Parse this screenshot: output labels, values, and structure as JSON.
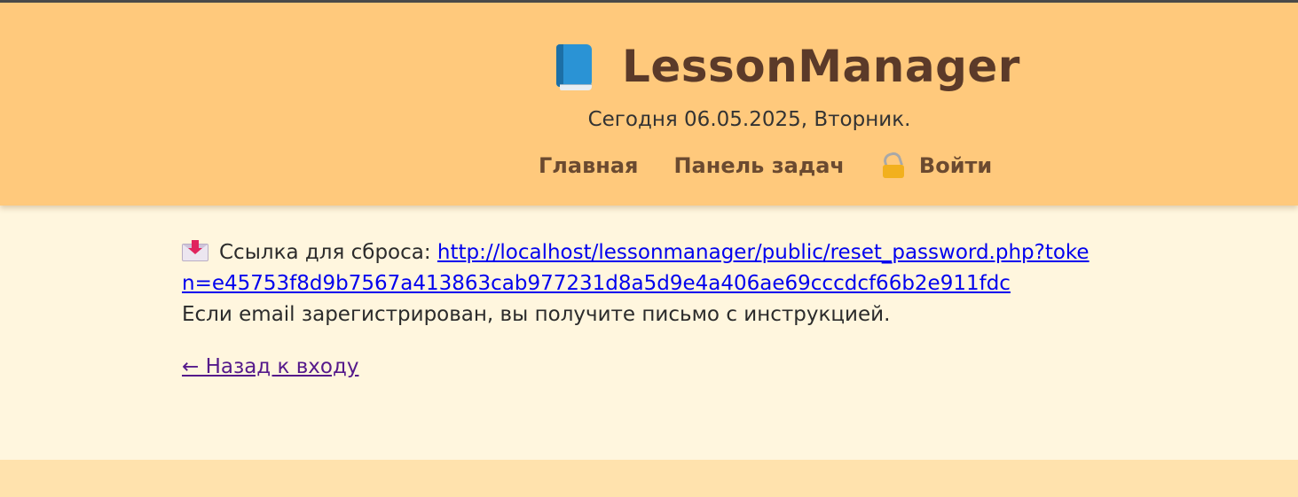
{
  "header": {
    "app_title": "LessonManager",
    "logo_icon": "blue-book-icon",
    "today_text": "Сегодня 06.05.2025, Вторник.",
    "nav": {
      "home_label": "Главная",
      "tasks_label": "Панель задач",
      "login_label": "Войти",
      "login_icon": "lock-icon"
    }
  },
  "main": {
    "mail_icon": "incoming-envelope-icon",
    "reset_prefix": "Ссылка для сброса:",
    "reset_url": "http://localhost/lessonmanager/public/reset_password.php?token=e45753f8d9b7567a413863cab977231d8a5d9e4a406ae69cccdcf66b2e911fdc",
    "info_text": "Если email зарегистрирован, вы получите письмо с инструкцией.",
    "back_link_label": "← Назад к входу"
  },
  "colors": {
    "header_bg": "#ffc97c",
    "main_bg": "#fff6de",
    "footer_bg": "#ffe2ad",
    "title_color": "#5b3a29",
    "link_color": "#0000ee",
    "visited_link_color": "#551a8b"
  }
}
